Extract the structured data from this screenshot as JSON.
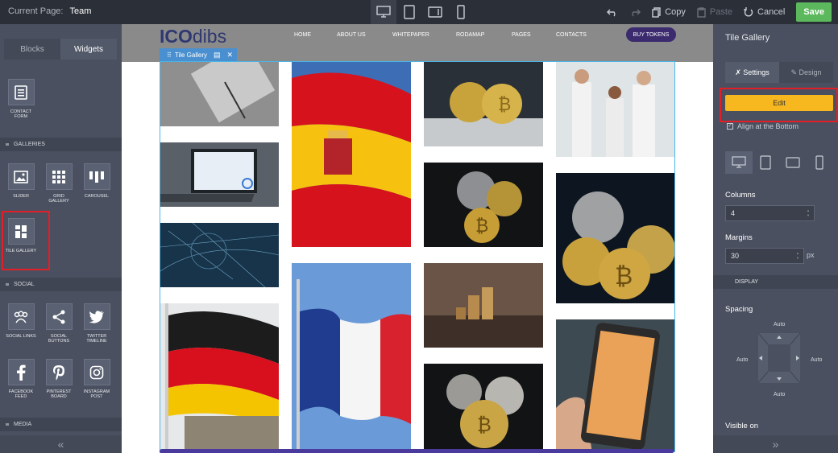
{
  "topbar": {
    "current_page_label": "Current Page:",
    "current_page_value": "Team",
    "actions": {
      "copy": "Copy",
      "paste": "Paste",
      "cancel": "Cancel",
      "save": "Save"
    }
  },
  "left_panel": {
    "tabs": [
      "Blocks",
      "Widgets"
    ],
    "active_tab": "Widgets",
    "contact_form": "CONTACT FORM",
    "sections": {
      "galleries": "GALLERIES",
      "social": "SOCIAL",
      "media": "MEDIA"
    },
    "galleries": [
      "SLIDER",
      "GRID GALLERY",
      "CAROUSEL",
      "TILE GALLERY"
    ],
    "social": [
      "SOCIAL LINKS",
      "SOCIAL BUTTONS",
      "TWITTER TIMELINE",
      "FACEBOOK FEED",
      "PINTEREST BOARD",
      "INSTAGRAM POST"
    ],
    "footer_icon": "«"
  },
  "site": {
    "logo_bold": "ICO",
    "logo_light": "dibs",
    "nav": [
      "HOME",
      "ABOUT US",
      "WHITEPAPER",
      "RODAMAP",
      "PAGES",
      "CONTACTS"
    ],
    "buy_button": "BUY TOKENS",
    "widget_tag": "Tile Gallery"
  },
  "right_panel": {
    "title": "Tile Gallery",
    "tabs": [
      "Settings",
      "Design"
    ],
    "edit_button": "Edit",
    "align_bottom": "Align at the Bottom",
    "columns_label": "Columns",
    "columns_value": "4",
    "margins_label": "Margins",
    "margins_value": "30",
    "margins_unit": "px",
    "display_section": "DISPLAY",
    "spacing_label": "Spacing",
    "spacing_values": {
      "top": "Auto",
      "left": "Auto",
      "right": "Auto",
      "bottom": "Auto"
    },
    "visible_on": "Visible on",
    "footer_icon": "»"
  },
  "colors": {
    "accent": "#f6b71f",
    "save": "#5cb85c",
    "highlight": "#e21f26",
    "selection": "#4ab6e8"
  }
}
